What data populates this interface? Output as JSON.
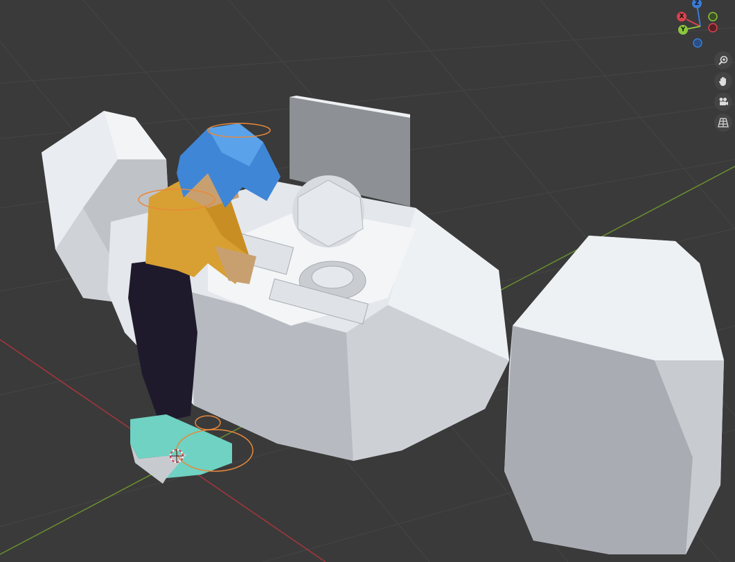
{
  "gizmo": {
    "axis_x": "X",
    "axis_y": "Y",
    "axis_z": "Z",
    "color_x": "#d9434d",
    "color_y": "#8cc63f",
    "color_z": "#3b7bd6"
  },
  "nav_tools": [
    {
      "name": "zoom-icon"
    },
    {
      "name": "hand-icon"
    },
    {
      "name": "camera-icon"
    },
    {
      "name": "grid-icon"
    }
  ],
  "colors": {
    "background": "#3a3a3a",
    "grid": "#444444",
    "x_axis": "#a8363c",
    "y_axis": "#6a8f2f",
    "shirt": "#d8a032",
    "hair": "#3f86d6",
    "pants": "#1f1a2b",
    "shoes": "#6fd2c2",
    "mesh": "#e5e8ed"
  }
}
